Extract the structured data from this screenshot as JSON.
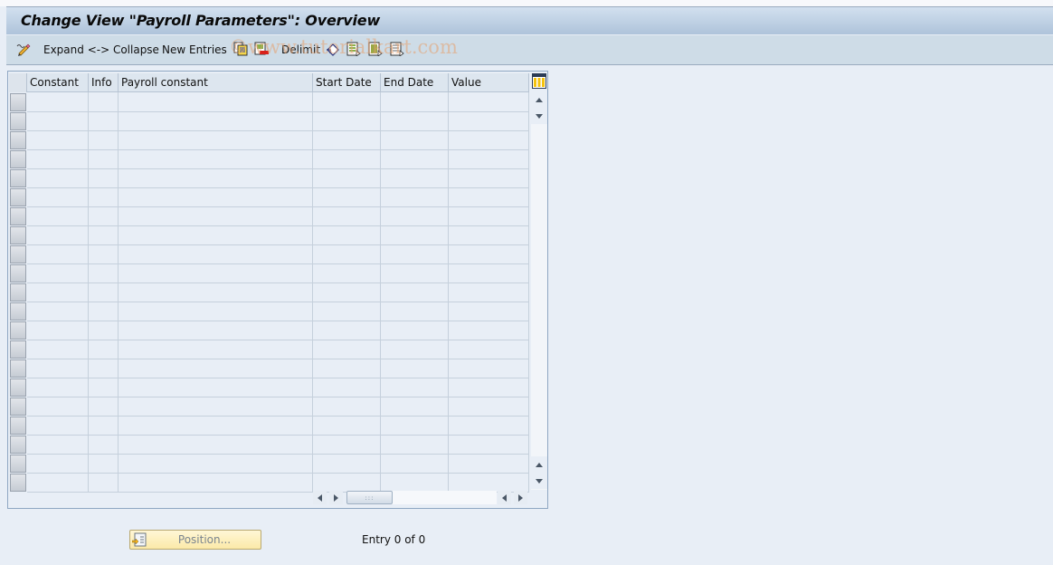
{
  "window": {
    "title": "Change View \"Payroll Parameters\": Overview"
  },
  "toolbar": {
    "items": [
      {
        "name": "display-change-icon",
        "label": ""
      },
      {
        "name": "expand-collapse",
        "label": "Expand <-> Collapse"
      },
      {
        "name": "new-entries",
        "label": "New Entries"
      },
      {
        "name": "copy-as-icon",
        "label": ""
      },
      {
        "name": "delete-icon",
        "label": ""
      },
      {
        "name": "delimit",
        "label": "Delimit"
      },
      {
        "name": "undo-change-icon",
        "label": ""
      },
      {
        "name": "select-all-icon",
        "label": ""
      },
      {
        "name": "select-block-icon",
        "label": ""
      },
      {
        "name": "deselect-all-icon",
        "label": ""
      }
    ],
    "watermark": "©www.tutorialkart.com"
  },
  "table": {
    "columns": [
      {
        "key": "constant",
        "label": "Constant"
      },
      {
        "key": "info",
        "label": "Info"
      },
      {
        "key": "payroll_constant",
        "label": "Payroll constant"
      },
      {
        "key": "start_date",
        "label": "Start Date"
      },
      {
        "key": "end_date",
        "label": "End Date"
      },
      {
        "key": "value",
        "label": "Value"
      }
    ],
    "rows": [],
    "visible_empty_rows": 21
  },
  "footer": {
    "position_button": "Position...",
    "entry_info": "Entry 0 of 0"
  },
  "colors": {
    "title_gradient_top": "#d2e0ef",
    "title_gradient_bottom": "#aec3da",
    "toolbar_bg": "#cedce7",
    "page_bg": "#e8eef6",
    "position_button_bg": "#fbe9a8"
  }
}
